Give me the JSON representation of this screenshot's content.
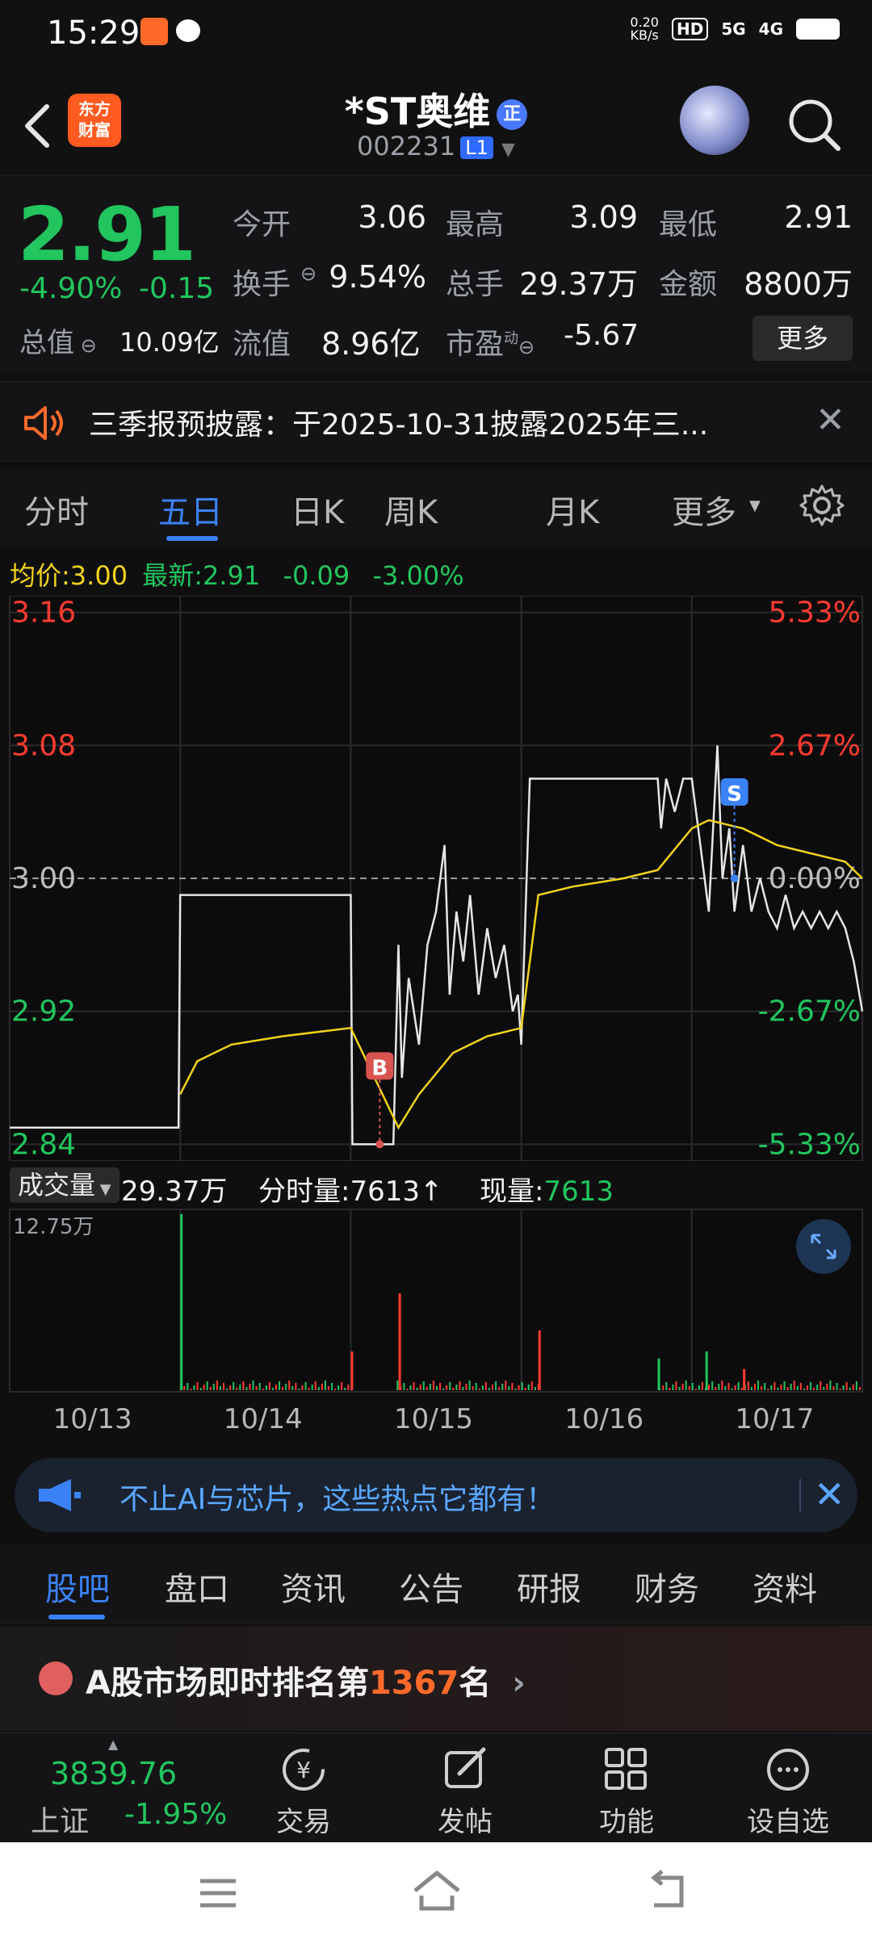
{
  "status_bar": {
    "time": "15:29",
    "net_speed": "0.20\nKB/s",
    "hd": "HD",
    "sig1": "5G",
    "sig2": "4G"
  },
  "header": {
    "logo": "东方\n财富",
    "title": "*ST奥维",
    "title_badge": "正",
    "code": "002231",
    "code_level": "L1"
  },
  "quote": {
    "price": "2.91",
    "change_pct": "-4.90%",
    "change_amt": "-0.15",
    "rows": [
      [
        {
          "label": "今开",
          "value": "3.06",
          "color": "white"
        },
        {
          "label": "最高",
          "value": "3.09",
          "color": "red"
        },
        {
          "label": "最低",
          "value": "2.91",
          "color": "green"
        }
      ],
      [
        {
          "label": "换手",
          "value": "9.54%",
          "color": "white"
        },
        {
          "label": "总手",
          "value": "29.37万",
          "color": "white"
        },
        {
          "label": "金额",
          "value": "8800万",
          "color": "white"
        }
      ]
    ],
    "row3": {
      "total_label": "总值",
      "total_value": "10.09亿",
      "float_label": "流值",
      "float_value": "8.96亿",
      "pe_label": "市盈",
      "pe_sup": "动",
      "pe_value": "-5.67"
    },
    "more_button": "更多"
  },
  "notice": {
    "text": "三季报预披露：于2025-10-31披露2025年三..."
  },
  "chart_tabs": [
    "分时",
    "五日",
    "日K",
    "周K",
    "月K",
    "更多"
  ],
  "chart_tab_active": 1,
  "legend": {
    "avg_label": "均价:",
    "avg_value": "3.00",
    "latest_label": "最新:",
    "latest_value": "2.91",
    "chg": "-0.09",
    "pct": "-3.00%"
  },
  "chart_data": {
    "type": "line",
    "title": "",
    "y_left_ticks": [
      "3.16",
      "3.08",
      "3.00",
      "2.92",
      "2.84"
    ],
    "y_right_ticks": [
      "5.33%",
      "2.67%",
      "0.00%",
      "-2.67%",
      "-5.33%"
    ],
    "x_labels": [
      "10/13",
      "10/14",
      "10/15",
      "10/16",
      "10/17"
    ],
    "ylim": [
      2.83,
      3.17
    ],
    "markers": [
      {
        "label": "B",
        "x": 2.17,
        "y": 2.84
      },
      {
        "label": "S",
        "x": 4.25,
        "y": 3.0
      }
    ],
    "series": [
      {
        "name": "price",
        "color": "#e6e6e6",
        "points": [
          [
            0,
            2.85
          ],
          [
            0.99,
            2.85
          ],
          [
            1.0,
            2.99
          ],
          [
            1.01,
            2.99
          ],
          [
            2.0,
            2.99
          ],
          [
            2.01,
            2.84
          ],
          [
            2.25,
            2.84
          ],
          [
            2.28,
            2.96
          ],
          [
            2.3,
            2.88
          ],
          [
            2.34,
            2.94
          ],
          [
            2.4,
            2.9
          ],
          [
            2.45,
            2.96
          ],
          [
            2.5,
            2.98
          ],
          [
            2.55,
            3.02
          ],
          [
            2.58,
            2.93
          ],
          [
            2.62,
            2.98
          ],
          [
            2.66,
            2.95
          ],
          [
            2.7,
            2.99
          ],
          [
            2.75,
            2.93
          ],
          [
            2.8,
            2.97
          ],
          [
            2.85,
            2.94
          ],
          [
            2.9,
            2.96
          ],
          [
            2.95,
            2.92
          ],
          [
            2.98,
            2.93
          ],
          [
            3.0,
            2.9
          ],
          [
            3.05,
            3.06
          ],
          [
            3.1,
            3.06
          ],
          [
            3.8,
            3.06
          ],
          [
            3.82,
            3.03
          ],
          [
            3.85,
            3.06
          ],
          [
            3.9,
            3.04
          ],
          [
            3.95,
            3.06
          ],
          [
            4.0,
            3.06
          ],
          [
            4.05,
            3.02
          ],
          [
            4.1,
            2.98
          ],
          [
            4.15,
            3.08
          ],
          [
            4.18,
            3.0
          ],
          [
            4.22,
            3.03
          ],
          [
            4.25,
            2.98
          ],
          [
            4.3,
            3.02
          ],
          [
            4.35,
            2.98
          ],
          [
            4.4,
            3.0
          ],
          [
            4.45,
            2.98
          ],
          [
            4.5,
            2.97
          ],
          [
            4.55,
            2.99
          ],
          [
            4.6,
            2.97
          ],
          [
            4.65,
            2.98
          ],
          [
            4.7,
            2.97
          ],
          [
            4.75,
            2.98
          ],
          [
            4.8,
            2.97
          ],
          [
            4.85,
            2.98
          ],
          [
            4.9,
            2.97
          ],
          [
            4.95,
            2.95
          ],
          [
            5.0,
            2.92
          ]
        ]
      },
      {
        "name": "avg",
        "color": "#f2d21b",
        "points": [
          [
            1.0,
            2.87
          ],
          [
            1.1,
            2.89
          ],
          [
            1.3,
            2.9
          ],
          [
            1.6,
            2.905
          ],
          [
            2.0,
            2.91
          ],
          [
            2.28,
            2.85
          ],
          [
            2.4,
            2.87
          ],
          [
            2.6,
            2.895
          ],
          [
            2.8,
            2.905
          ],
          [
            3.0,
            2.91
          ],
          [
            3.05,
            2.95
          ],
          [
            3.1,
            2.99
          ],
          [
            3.3,
            2.995
          ],
          [
            3.6,
            3.0
          ],
          [
            3.8,
            3.005
          ],
          [
            4.0,
            3.03
          ],
          [
            4.1,
            3.035
          ],
          [
            4.3,
            3.03
          ],
          [
            4.5,
            3.02
          ],
          [
            4.7,
            3.015
          ],
          [
            4.9,
            3.01
          ],
          [
            5.0,
            3.0
          ]
        ]
      }
    ]
  },
  "volume": {
    "label": "成交量",
    "total": "29.37万",
    "minute_label": "分时量:",
    "minute_value": "7613",
    "now_label": "现量:",
    "now_value": "7613",
    "max_label": "12.75万",
    "spikes": [
      [
        1.0,
        1.0,
        "green"
      ],
      [
        2.0,
        0.22,
        "red"
      ],
      [
        2.28,
        0.55,
        "red"
      ],
      [
        3.1,
        0.34,
        "red"
      ],
      [
        3.8,
        0.18,
        "green"
      ],
      [
        4.08,
        0.22,
        "green"
      ],
      [
        4.3,
        0.12,
        "red"
      ]
    ]
  },
  "ad": {
    "text": "不止AI与芯片，这些热点它都有！"
  },
  "bottom_tabs": [
    "股吧",
    "盘口",
    "资讯",
    "公告",
    "研报",
    "财务",
    "资料"
  ],
  "bottom_tab_active": 0,
  "rank": {
    "prefix": "A股市场即时排名第",
    "number": "1367",
    "suffix": "名"
  },
  "toolbar": {
    "index_value": "3839.76",
    "index_name": "上证",
    "index_change": "-1.95%",
    "tools": [
      "交易",
      "发帖",
      "功能",
      "设自选"
    ]
  }
}
